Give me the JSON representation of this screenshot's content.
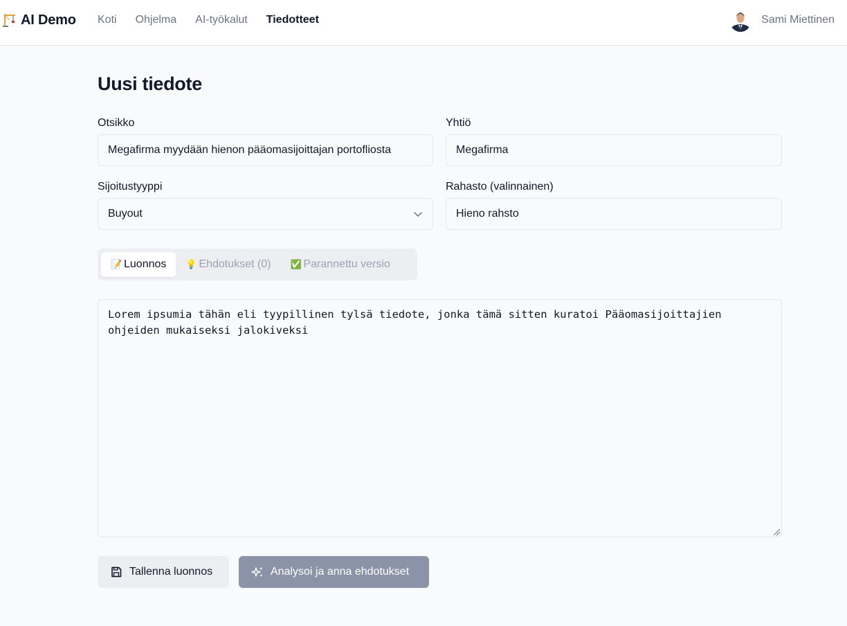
{
  "nav": {
    "brand": "AI Demo",
    "links": [
      "Koti",
      "Ohjelma",
      "AI-työkalut",
      "Tiedotteet"
    ],
    "active_index": 3,
    "user_name": "Sami Miettinen"
  },
  "form": {
    "title": "Uusi tiedote",
    "headline_label": "Otsikko",
    "headline_value": "Megafirma myydään hienon pääomasijoittajan portofliosta",
    "company_label": "Yhtiö",
    "company_value": "Megafirma",
    "investment_type_label": "Sijoitustyyppi",
    "investment_type_value": "Buyout",
    "fund_label": "Rahasto (valinnainen)",
    "fund_value": "Hieno rahsto"
  },
  "tabs": [
    {
      "emoji": "📝",
      "label": "Luonnos",
      "state": "active"
    },
    {
      "emoji": "💡",
      "label": "Ehdotukset (0)",
      "state": "disabled"
    },
    {
      "emoji": "✅",
      "label": "Parannettu versio",
      "state": "disabled"
    }
  ],
  "draft_text": "Lorem ipsumia tähän eli tyypillinen tylsä tiedote, jonka tämä sitten kuratoi Pääomasijoittajien ohjeiden mukaiseksi jalokiveksi",
  "actions": {
    "save_label": "Tallenna luonnos",
    "analyze_label": "Analysoi ja anna ehdotukset"
  },
  "colors": {
    "page_bg": "#f9fafb",
    "analyze_button": "#8a93a8",
    "secondary_button": "#eceef2"
  }
}
